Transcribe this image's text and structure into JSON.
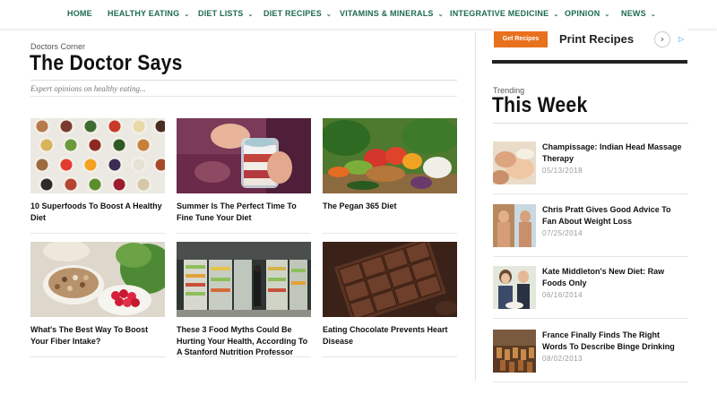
{
  "nav": {
    "items": [
      {
        "label": "HOME",
        "dropdown": false
      },
      {
        "label": "HEALTHY EATING",
        "dropdown": true
      },
      {
        "label": "DIET LISTS",
        "dropdown": true
      },
      {
        "label": "DIET RECIPES",
        "dropdown": true
      },
      {
        "label": "VITAMINS & MINERALS",
        "dropdown": true
      },
      {
        "label": "INTEGRATIVE MEDICINE",
        "dropdown": true
      },
      {
        "label": "OPINION",
        "dropdown": true
      },
      {
        "label": "NEWS",
        "dropdown": true
      }
    ],
    "chevron": "⌄",
    "color": "#1e6b4f"
  },
  "main": {
    "kicker": "Doctors Corner",
    "title": "The Doctor Says",
    "subtitle": "Expert opinions on healthy eating...",
    "articles": [
      {
        "title": "10 Superfoods To Boost A Healthy Diet",
        "image": "superfood-bowls"
      },
      {
        "title": "Summer Is The Perfect Time To Fine Tune Your Diet",
        "image": "parfait-jar"
      },
      {
        "title": "The Pegan 365 Diet",
        "image": "vegetable-basket"
      },
      {
        "title": "What's The Best Way To Boost Your Fiber Intake?",
        "image": "beans-raspberries"
      },
      {
        "title": "These 3 Food Myths Could Be Hurting Your Health, According To A Stanford Nutrition Professor",
        "image": "supermarket-aisle"
      },
      {
        "title": "Eating Chocolate Prevents Heart Disease",
        "image": "chocolate-bar"
      }
    ]
  },
  "ad": {
    "button_label": "Get Recipes",
    "text": "Print Recipes",
    "arrow_icon": "chevron-right-icon",
    "adchoices_icon": "ad-choices-icon"
  },
  "trending": {
    "kicker": "Trending",
    "title": "This Week",
    "items": [
      {
        "title": "Champissage: Indian Head Massage Therapy",
        "date": "05/13/2018",
        "image": "massage"
      },
      {
        "title": "Chris Pratt Gives Good Advice To Fan About Weight Loss",
        "date": "07/25/2014",
        "image": "chris-pratt"
      },
      {
        "title": "Kate Middleton's New Diet: Raw Foods Only",
        "date": "06/16/2014",
        "image": "kate-middleton"
      },
      {
        "title": "France Finally Finds The Right Words To Describe Binge Drinking",
        "date": "08/02/2013",
        "image": "wine-glasses"
      }
    ]
  }
}
